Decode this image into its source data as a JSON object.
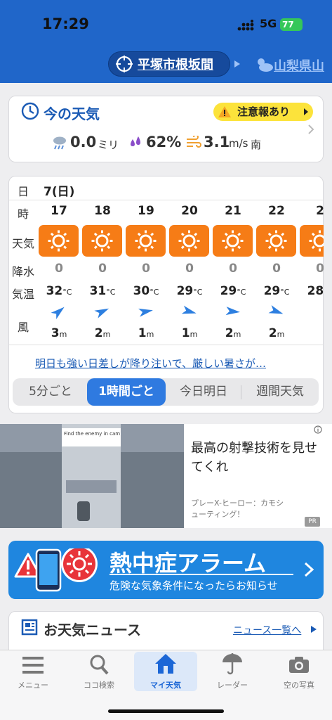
{
  "status_bar": {
    "time": "17:29",
    "network": "5G",
    "battery": "77"
  },
  "header": {
    "location": "平塚市根坂間",
    "next_location": "山梨県山"
  },
  "now": {
    "title": "今の天気",
    "warning": "注意報あり",
    "rain_value": "0.0",
    "rain_unit": "ミリ",
    "humidity": "62%",
    "wind_value": "3.1",
    "wind_unit": "m/s",
    "wind_dir": "南"
  },
  "forecast": {
    "labels": {
      "day": "日",
      "hour": "時",
      "weather": "天気",
      "rain": "降水",
      "temp": "気温",
      "wind": "風"
    },
    "date": "7(日)",
    "temp_unit": "°C",
    "wind_unit": "m",
    "hours": [
      {
        "hour": "17",
        "rain": "0",
        "temp": "32",
        "wind": "3",
        "icon": "sun-icon"
      },
      {
        "hour": "18",
        "rain": "0",
        "temp": "31",
        "wind": "2",
        "icon": "sun-icon"
      },
      {
        "hour": "19",
        "rain": "0",
        "temp": "30",
        "wind": "1",
        "icon": "sun-icon"
      },
      {
        "hour": "20",
        "rain": "0",
        "temp": "29",
        "wind": "1",
        "icon": "sun-icon"
      },
      {
        "hour": "21",
        "rain": "0",
        "temp": "29",
        "wind": "2",
        "icon": "sun-icon"
      },
      {
        "hour": "22",
        "rain": "0",
        "temp": "29",
        "wind": "2",
        "icon": "sun-icon"
      },
      {
        "hour": "2",
        "rain": "0",
        "temp": "28",
        "wind": "",
        "icon": "sun-icon"
      }
    ],
    "summary": "明日も強い日差しが降り注いで、厳しい暑さが…",
    "tabs": [
      "5分ごと",
      "1時間ごと",
      "今日明日",
      "週間天気"
    ],
    "active_tab": "1時間ごと"
  },
  "ad": {
    "game_caption": "Find the enemy in camouflage!",
    "headline": "最高の射撃技術を見せてくれ",
    "sponsor": "プレーX-ヒーロー：カモシューティング！",
    "badge": "PR"
  },
  "banner": {
    "title": "熱中症アラーム",
    "subtitle": "危険な気象条件になったらお知らせ"
  },
  "news": {
    "title": "お天気ニュース",
    "link": "ニュース一覧へ"
  },
  "tabbar": {
    "items": [
      "メニュー",
      "ココ検索",
      "マイ天気",
      "レーダー",
      "空の写真"
    ],
    "active": "マイ天気"
  },
  "colors": {
    "brand_blue": "#2066c9",
    "sun_orange": "#f67c16",
    "warning_yellow": "#fce33b",
    "active_tab": "#2f7ae0"
  }
}
